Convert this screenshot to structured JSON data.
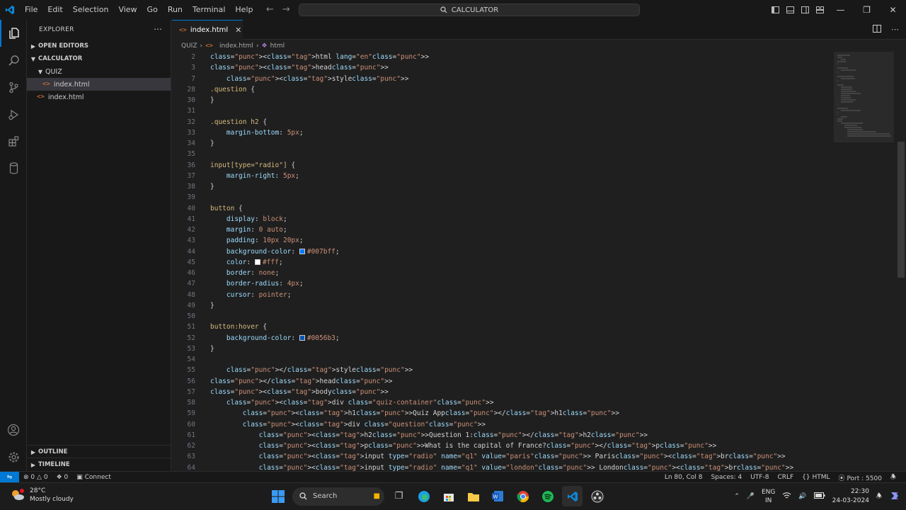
{
  "titlebar": {
    "menu": [
      "File",
      "Edit",
      "Selection",
      "View",
      "Go",
      "Run",
      "Terminal",
      "Help"
    ],
    "search_text": "CALCULATOR"
  },
  "sidebar": {
    "title": "EXPLORER",
    "open_editors": "OPEN EDITORS",
    "folder": "CALCULATOR",
    "subfolder": "QUIZ",
    "file_in_quiz": "index.html",
    "file_root": "index.html",
    "outline": "OUTLINE",
    "timeline": "TIMELINE"
  },
  "tab": {
    "label": "index.html"
  },
  "breadcrumb": {
    "folder": "QUIZ",
    "file": "index.html",
    "symbol": "html"
  },
  "code_lines": [
    {
      "n": "2",
      "code": "<html lang=\"en\">"
    },
    {
      "n": "3",
      "code": "<head>"
    },
    {
      "n": "7",
      "code": "    <style>"
    },
    {
      "n": "28",
      "code": ".question {"
    },
    {
      "n": "30",
      "code": "}"
    },
    {
      "n": "31",
      "code": ""
    },
    {
      "n": "32",
      "code": ".question h2 {"
    },
    {
      "n": "33",
      "code": "    margin-bottom: 5px;"
    },
    {
      "n": "34",
      "code": "}"
    },
    {
      "n": "35",
      "code": ""
    },
    {
      "n": "36",
      "code": "input[type=\"radio\"] {"
    },
    {
      "n": "37",
      "code": "    margin-right: 5px;"
    },
    {
      "n": "38",
      "code": "}"
    },
    {
      "n": "39",
      "code": ""
    },
    {
      "n": "40",
      "code": "button {"
    },
    {
      "n": "41",
      "code": "    display: block;"
    },
    {
      "n": "42",
      "code": "    margin: 0 auto;"
    },
    {
      "n": "43",
      "code": "    padding: 10px 20px;"
    },
    {
      "n": "44",
      "code": "    background-color: #007bff;"
    },
    {
      "n": "45",
      "code": "    color: #fff;"
    },
    {
      "n": "46",
      "code": "    border: none;"
    },
    {
      "n": "47",
      "code": "    border-radius: 4px;"
    },
    {
      "n": "48",
      "code": "    cursor: pointer;"
    },
    {
      "n": "49",
      "code": "}"
    },
    {
      "n": "50",
      "code": ""
    },
    {
      "n": "51",
      "code": "button:hover {"
    },
    {
      "n": "52",
      "code": "    background-color: #0056b3;"
    },
    {
      "n": "53",
      "code": "}"
    },
    {
      "n": "54",
      "code": ""
    },
    {
      "n": "55",
      "code": "    </style>"
    },
    {
      "n": "56",
      "code": "</head>"
    },
    {
      "n": "57",
      "code": "<body>"
    },
    {
      "n": "58",
      "code": "    <div class=\"quiz-container\">"
    },
    {
      "n": "59",
      "code": "        <h1>Quiz App</h1>"
    },
    {
      "n": "60",
      "code": "        <div class=\"question\">"
    },
    {
      "n": "61",
      "code": "            <h2>Question 1:</h2>"
    },
    {
      "n": "62",
      "code": "            <p>What is the capital of France?</p>"
    },
    {
      "n": "63",
      "code": "            <input type=\"radio\" name=\"q1\" value=\"paris\"> Paris<br>"
    },
    {
      "n": "64",
      "code": "            <input type=\"radio\" name=\"q1\" value=\"london\"> London<br>"
    }
  ],
  "status": {
    "errors": "0",
    "warnings": "0",
    "ports": "0",
    "connect": "Connect",
    "position": "Ln 80, Col 8",
    "spaces": "Spaces: 4",
    "encoding": "UTF-8",
    "eol": "CRLF",
    "language": "HTML",
    "port": "Port : 5500"
  },
  "taskbar": {
    "temp": "28°C",
    "weather": "Mostly cloudy",
    "search": "Search",
    "lang1": "ENG",
    "lang2": "IN",
    "time": "22:30",
    "date": "24-03-2024"
  },
  "colors": {
    "accent": "#0078d4",
    "swatch_blue": "#007bff",
    "swatch_white": "#ffffff",
    "swatch_dark_blue": "#0056b3"
  }
}
